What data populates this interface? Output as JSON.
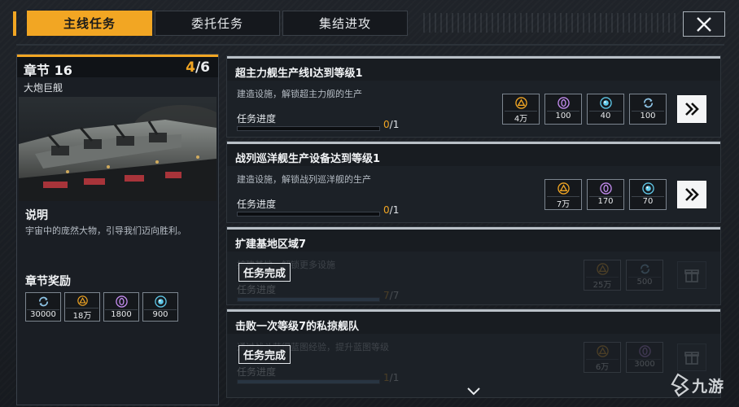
{
  "tabs": [
    {
      "label": "主线任务",
      "active": true
    },
    {
      "label": "委托任务",
      "active": false
    },
    {
      "label": "集结进攻",
      "active": false
    }
  ],
  "close_icon": "close-icon",
  "chapter": {
    "title": "章节 16",
    "progress_current": "4",
    "progress_sep": "/",
    "progress_total": "6",
    "subtitle": "大炮巨舰",
    "desc_title": "说明",
    "desc_text": "宇宙中的庞然大物，引导我们迈向胜利。",
    "reward_title": "章节奖励",
    "rewards": [
      {
        "icon": "cycle-icon",
        "color": "#8fc6e8",
        "value": "30000"
      },
      {
        "icon": "triangle-icon",
        "color": "#f2a623",
        "value": "18万"
      },
      {
        "icon": "crystal-icon",
        "color": "#c48cf0",
        "value": "1800"
      },
      {
        "icon": "orb-icon",
        "color": "#5fc8e8",
        "value": "900"
      }
    ]
  },
  "tasks": [
    {
      "title": "超主力舰生产线l达到等级1",
      "desc": "建造设施，解锁超主力舰的生产",
      "progress_label": "任务进度",
      "progress_current": "0",
      "progress_total": "1",
      "progress_fraction": 0,
      "done": false,
      "rewards": [
        {
          "icon": "triangle-icon",
          "color": "#f2a623",
          "value": "4万"
        },
        {
          "icon": "crystal-icon",
          "color": "#c48cf0",
          "value": "100"
        },
        {
          "icon": "orb-icon",
          "color": "#5fc8e8",
          "value": "40"
        },
        {
          "icon": "cycle-icon",
          "color": "#8fc6e8",
          "value": "100"
        }
      ],
      "action_icon": "double-chevron-right-icon"
    },
    {
      "title": "战列巡洋舰生产设备达到等级1",
      "desc": "建造设施，解锁战列巡洋舰的生产",
      "progress_label": "任务进度",
      "progress_current": "0",
      "progress_total": "1",
      "progress_fraction": 0,
      "done": false,
      "rewards": [
        {
          "icon": "triangle-icon",
          "color": "#f2a623",
          "value": "7万"
        },
        {
          "icon": "crystal-icon",
          "color": "#c48cf0",
          "value": "170"
        },
        {
          "icon": "orb-icon",
          "color": "#5fc8e8",
          "value": "70"
        }
      ],
      "action_icon": "double-chevron-right-icon"
    },
    {
      "title": "扩建基地区域7",
      "desc": "扩建基地，解锁更多设施",
      "progress_label": "任务进度",
      "progress_current": "7",
      "progress_total": "7",
      "progress_fraction": 1,
      "done": true,
      "done_label": "任务完成",
      "rewards": [
        {
          "icon": "triangle-icon",
          "color": "#f2a623",
          "value": "25万"
        },
        {
          "icon": "cycle-icon",
          "color": "#8fc6e8",
          "value": "500"
        }
      ],
      "action_icon": "gift-icon"
    },
    {
      "title": "击败一次等级7的私掠舰队",
      "desc": "通过战斗获得蓝图经验，提升蓝图等级",
      "progress_label": "任务进度",
      "progress_current": "1",
      "progress_total": "1",
      "progress_fraction": 1,
      "done": true,
      "done_label": "任务完成",
      "rewards": [
        {
          "icon": "triangle-icon",
          "color": "#f2a623",
          "value": "6万"
        },
        {
          "icon": "crystal-icon",
          "color": "#c48cf0",
          "value": "3000"
        }
      ],
      "action_icon": "gift-icon"
    }
  ],
  "scroll_icon": "chevron-down-icon",
  "watermark": {
    "text": "九游",
    "icon": "watermark-logo-icon"
  }
}
